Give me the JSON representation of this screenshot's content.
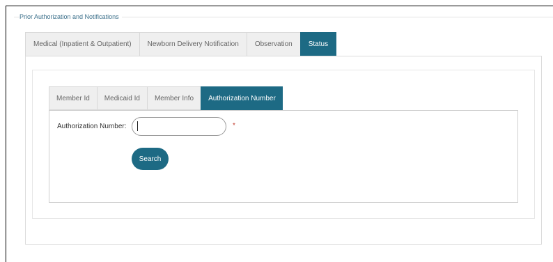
{
  "section": {
    "title": "Prior Authorization and Notifications"
  },
  "tabs": [
    {
      "label": "Medical (Inpatient & Outpatient)"
    },
    {
      "label": "Newborn Delivery Notification"
    },
    {
      "label": "Observation"
    },
    {
      "label": "Status",
      "active": true
    }
  ],
  "subtabs": [
    {
      "label": "Member Id"
    },
    {
      "label": "Medicaid Id"
    },
    {
      "label": "Member Info"
    },
    {
      "label": "Authorization Number",
      "active": true
    }
  ],
  "form": {
    "auth_label": "Authorization Number:",
    "auth_value": "",
    "required_mark": "*",
    "search_label": "Search"
  },
  "colors": {
    "accent": "#1d6a84",
    "legend": "#3b6f8a",
    "required": "#c0392b"
  }
}
